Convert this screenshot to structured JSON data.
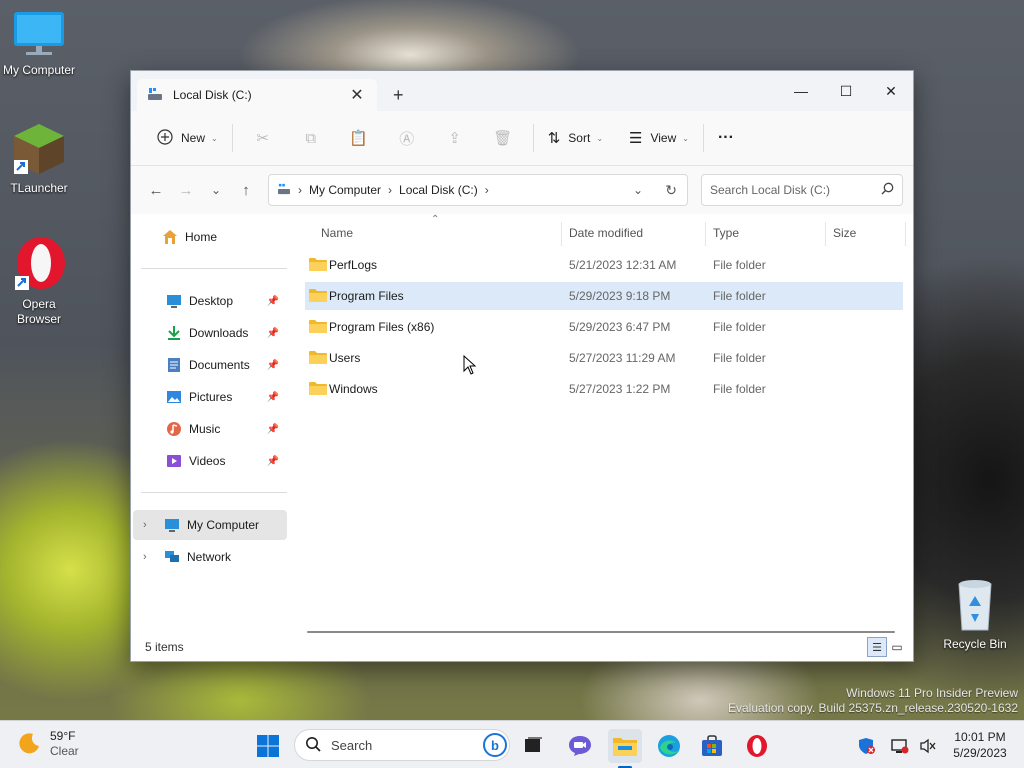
{
  "desktop": {
    "icons": [
      {
        "label": "My Computer"
      },
      {
        "label": "TLauncher"
      },
      {
        "label": "Opera\nBrowser"
      },
      {
        "label": "Recycle Bin"
      }
    ],
    "watermark": {
      "line1": "Windows 11 Pro Insider Preview",
      "line2": "Evaluation copy. Build 25375.zn_release.230520-1632"
    }
  },
  "window": {
    "tab_title": "Local Disk (C:)",
    "controls": {
      "minimize": "—",
      "maximize": "☐",
      "close": "✕"
    },
    "toolbar": {
      "new_label": "New",
      "sort_label": "Sort",
      "view_label": "View",
      "more": "···"
    },
    "address": {
      "crumbs": [
        "My Computer",
        "Local Disk (C:)"
      ]
    },
    "search": {
      "placeholder": "Search Local Disk (C:)"
    },
    "nav": {
      "home": "Home",
      "quick": [
        {
          "label": "Desktop",
          "icon": "desktop-icon"
        },
        {
          "label": "Downloads",
          "icon": "downloads-icon"
        },
        {
          "label": "Documents",
          "icon": "documents-icon"
        },
        {
          "label": "Pictures",
          "icon": "pictures-icon"
        },
        {
          "label": "Music",
          "icon": "music-icon"
        },
        {
          "label": "Videos",
          "icon": "videos-icon"
        }
      ],
      "my_computer": "My Computer",
      "network": "Network"
    },
    "columns": {
      "name": "Name",
      "date": "Date modified",
      "type": "Type",
      "size": "Size"
    },
    "files": [
      {
        "name": "PerfLogs",
        "date": "5/21/2023 12:31 AM",
        "type": "File folder"
      },
      {
        "name": "Program Files",
        "date": "5/29/2023 9:18 PM",
        "type": "File folder"
      },
      {
        "name": "Program Files (x86)",
        "date": "5/29/2023 6:47 PM",
        "type": "File folder"
      },
      {
        "name": "Users",
        "date": "5/27/2023 11:29 AM",
        "type": "File folder"
      },
      {
        "name": "Windows",
        "date": "5/27/2023 1:22 PM",
        "type": "File folder"
      }
    ],
    "status": "5 items"
  },
  "taskbar": {
    "weather": {
      "temp": "59°F",
      "cond": "Clear"
    },
    "search_placeholder": "Search",
    "clock": {
      "time": "10:01 PM",
      "date": "5/29/2023"
    }
  },
  "colors": {
    "accent": "#0067c0",
    "selection": "#dce9f8",
    "folder": "#f8c840"
  }
}
